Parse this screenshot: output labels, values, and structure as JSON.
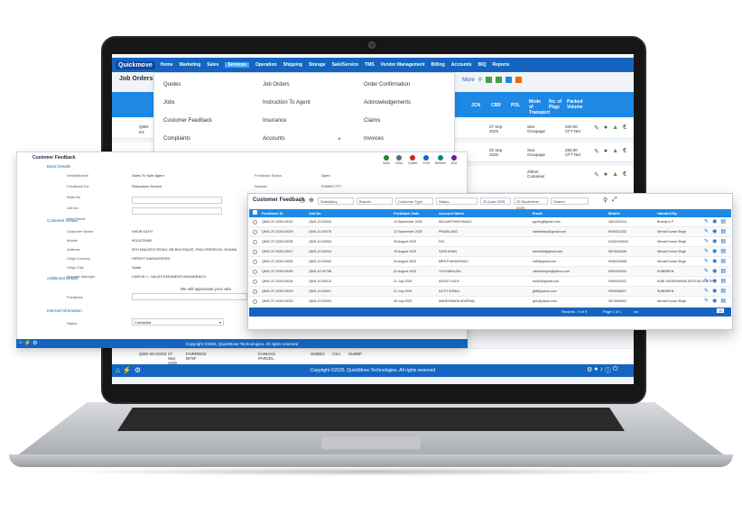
{
  "app": {
    "logo": "Quickmove",
    "nav": [
      "Home",
      "Marketing",
      "Sales",
      "Services",
      "Operation",
      "Shipping",
      "Storage",
      "Sale/Service",
      "TMS",
      "Vendor Management",
      "Billing",
      "Accounts",
      "BIQ",
      "Reports"
    ],
    "active_nav": "Services",
    "top_icons": {
      "search": "⚲",
      "settings": "⚙",
      "avatar": ""
    }
  },
  "job_orders": {
    "title": "Job Orders",
    "menu": {
      "col1": [
        "Quotes",
        "Jobs",
        "Customer Feedback",
        "Complaints"
      ],
      "col2": [
        "Job Orders",
        "Instruction To Agent",
        "Insurance",
        "Accounts"
      ],
      "col3": [
        "Order Confirmation",
        "Acknowledgements",
        "Claims",
        "Invoices"
      ]
    },
    "toolbar_label": "More",
    "headers": [
      "JCN",
      "CBR",
      "POL",
      "Mode of Transport",
      "No. of Pkgs",
      "Packed Volume"
    ],
    "rows": [
      {
        "a": "QMS-",
        "b": "EX",
        "c": "27 Sep 2025",
        "d": "Sea Groupage",
        "e": "200.00 CFT Net"
      },
      {
        "a": "QMS-",
        "b": "EX",
        "c": "22 Sep 2025",
        "d": "Sea Groupage",
        "e": "250.00 CFT Net"
      },
      {
        "a": "",
        "b": "",
        "c": "",
        "d": "20feet Container",
        "e": ""
      }
    ],
    "bottom_line": [
      "QMS-25-01103",
      "27 Sep 2025",
      "FAIRREDS DFSF",
      "KANHAN PARCEL",
      "SUBBO",
      "CSA",
      "SUBBF"
    ],
    "footer": "Copyright ©2025, QuickMove Technologies. All rights reserved"
  },
  "feedback_form": {
    "title": "Customer Feedback",
    "sections": [
      "Basic Details",
      "Customer Details",
      "Additional Details",
      "Internal Information"
    ],
    "fields_left": [
      {
        "label": "Serial/Branch",
        "value": "Sales To Sale Agent"
      },
      {
        "label": "Feedback For",
        "value": "Relocation Service"
      },
      {
        "label": "Rolls No",
        "value": ""
      },
      {
        "label": "Job No",
        "value": ""
      },
      {
        "label": "Prev Feeds",
        "value": ""
      }
    ],
    "fields_right": [
      {
        "label": "Feedback Status",
        "value": "Open"
      },
      {
        "label": "Number",
        "value": "F00000-TTT"
      },
      {
        "label": "Delivery Date",
        "value": ""
      }
    ],
    "customer_fields": [
      {
        "label": "Customer Name",
        "value": "KNOB KATH"
      },
      {
        "label": "Mobile",
        "value": "9012478450"
      },
      {
        "label": "Address",
        "value": "BTH MALDEVI ROAD, AB BHUTALEE, PHILOSEREIYA, GHANA"
      },
      {
        "label": "Origin Country",
        "value": "HIRSHT KARANTATEN"
      },
      {
        "label": "Origin City",
        "value": "Salah"
      },
      {
        "label": "Account Manager",
        "value": "CARON J - SALES ENGINEER ANUARBACH"
      }
    ],
    "feedback_label": "Feedback",
    "note": "We will appreciate your valu",
    "status_label": "Status",
    "status_value": "Contacted",
    "toolbar": [
      "Save",
      "Clear",
      "Delete",
      "Print",
      "Refresh",
      "Exit"
    ],
    "footer": "Copyright ©2025, QuickMove Technologies. All rights reserved"
  },
  "feedback_list": {
    "title": "Customer Feedback",
    "filters": [
      "Subsidiary",
      "Branch",
      "Customer Type",
      "Status",
      "25 June 2025",
      "25 September 2025",
      "Search"
    ],
    "headers": [
      "Feedback ID",
      "Job No",
      "Feedback Date",
      "Account Name",
      "Email",
      "Mobile",
      "Handled By"
    ],
    "rows": [
      [
        "QMS-CF-2025-00010",
        "QMS-JO-00043",
        "14 September 2025",
        "MS.KARTHIKEYANAO",
        "jaydeq@gmail.com",
        "3401002414",
        "Brandy A.P"
      ],
      [
        "QMS-CF-2025-00009",
        "QMS-JO-00076",
        "13 September 2025",
        "PRAMILADG",
        "satinthesol@gmail.com",
        "9040001333",
        "Nirmal Kumar Singh"
      ],
      [
        "QMS-CF-2025-00008",
        "QMS-JO-00063",
        "30 August 2025",
        "FAY",
        "",
        "04342404042",
        "Nirmal Kumar Singh"
      ],
      [
        "QMS-CF-2025-00007",
        "QMS-JO-00044",
        "15 August 2025",
        "SAFA KHAN",
        "tkshedhi@gmail.com",
        "9874034456",
        "Nirmal Kumar Singh"
      ],
      [
        "QMS-CF-2025-00006",
        "QMS-JO-00040",
        "04 August 2025",
        "MRS.R.BHARDWAJ",
        "rraff@gmail.com",
        "9940200608",
        "Nirmal Kumar Singh"
      ],
      [
        "QMS-CF-2025-00005",
        "QMS-JO-00758",
        "01 August 2025",
        "YOGHARAJSA",
        "nikeshdeyes@yahoo.com",
        "9000002510",
        "SUBBIREN"
      ],
      [
        "QMS-CF-2025-00004",
        "QMS-JO-00013",
        "21 July 2025",
        "AGENT A.B.N",
        "trudet@gmail.com",
        "9050004302",
        "SUBI SURENDIRAN MOTHULOCKTE"
      ],
      [
        "QMS-CF-2025-00003",
        "QMS-JO-00001",
        "21 July 2025",
        "AJITH SOMAL",
        "jjhlt@yahoo.com",
        "9094048007",
        "SUBBIREN"
      ],
      [
        "QMS-CF-2025-00002",
        "QMS-JO-00004",
        "05 July 2025",
        "MAHESWARA ADARVAL",
        "gee@yahoo.com",
        "9974645000",
        "Nirmal Kumar Singh"
      ]
    ],
    "footer_records": "Records : 9 of 9",
    "footer_page": "Page 1 of 1",
    "footer_size": "10"
  }
}
